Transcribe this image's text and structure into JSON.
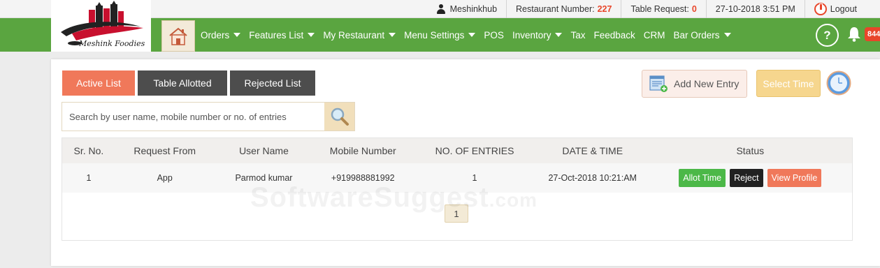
{
  "topbar": {
    "user": "Meshinkhub",
    "restaurant_label": "Restaurant Number:",
    "restaurant_number": "227",
    "table_request_label": "Table Request:",
    "table_request_count": "0",
    "datetime": "27-10-2018 3:51 PM",
    "logout": "Logout"
  },
  "brand": {
    "logo_text": "Meshink Foodies"
  },
  "nav": {
    "items": [
      {
        "label": "Orders",
        "dropdown": true
      },
      {
        "label": "Features List",
        "dropdown": true
      },
      {
        "label": "My Restaurant",
        "dropdown": true
      },
      {
        "label": "Menu Settings",
        "dropdown": true
      },
      {
        "label": "POS",
        "dropdown": false
      },
      {
        "label": "Inventory",
        "dropdown": true
      },
      {
        "label": "Tax",
        "dropdown": false
      },
      {
        "label": "Feedback",
        "dropdown": false
      },
      {
        "label": "CRM",
        "dropdown": false
      },
      {
        "label": "Bar Orders",
        "dropdown": true
      }
    ],
    "help": "?",
    "notification_count": "844"
  },
  "tabs": [
    "Active List",
    "Table Allotted",
    "Rejected List"
  ],
  "actions": {
    "add_entry": "Add New Entry",
    "select_time": "Select Time"
  },
  "search": {
    "placeholder": "Search by user name, mobile number or no. of entries",
    "value": ""
  },
  "table": {
    "headers": [
      "Sr. No.",
      "Request From",
      "User Name",
      "Mobile Number",
      "NO. OF ENTRIES",
      "DATE & TIME",
      "Status"
    ],
    "rows": [
      {
        "sr": "1",
        "from": "App",
        "user": "Parmod kumar",
        "mobile": "+919988881992",
        "entries": "1",
        "datetime": "27-Oct-2018 10:21:AM",
        "actions": [
          "Allot Time",
          "Reject",
          "View Profile"
        ]
      }
    ]
  },
  "pagination": {
    "current": "1"
  },
  "watermark": {
    "main": "SoftwareSuggest",
    "suffix": ".com"
  },
  "colors": {
    "nav_green": "#5aa540",
    "accent_orange": "#f0785a",
    "alert_red": "#e8462a",
    "dark_tab": "#4d4d4d"
  }
}
